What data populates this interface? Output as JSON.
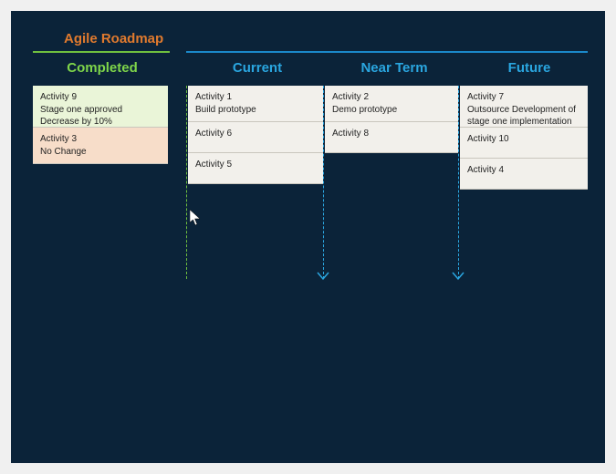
{
  "title": "Agile Roadmap",
  "columns": {
    "completed": {
      "label": "Completed",
      "cards": [
        {
          "title": "Activity 9",
          "desc": "Stage one approved\nDecrease by 10%"
        },
        {
          "title": "Activity 3",
          "desc": "No Change"
        }
      ]
    },
    "current": {
      "label": "Current",
      "cards": [
        {
          "title": "Activity 1",
          "desc": "Build prototype"
        },
        {
          "title": "Activity 6",
          "desc": ""
        },
        {
          "title": "Activity 5",
          "desc": ""
        }
      ]
    },
    "near_term": {
      "label": "Near Term",
      "cards": [
        {
          "title": "Activity 2",
          "desc": "Demo prototype"
        },
        {
          "title": "Activity 8",
          "desc": ""
        }
      ]
    },
    "future": {
      "label": "Future",
      "cards": [
        {
          "title": "Activity 7",
          "desc": "Outsource Development of stage one implementation"
        },
        {
          "title": "Activity 10",
          "desc": ""
        },
        {
          "title": "Activity 4",
          "desc": ""
        }
      ]
    }
  },
  "colors": {
    "bg": "#0b2339",
    "accent_orange": "#e07a2e",
    "accent_green": "#6fbf3f",
    "accent_blue": "#2aa6e0",
    "card_default": "#f2f0eb",
    "card_green": "#eaf5d8",
    "card_peach": "#f7ddc9"
  }
}
